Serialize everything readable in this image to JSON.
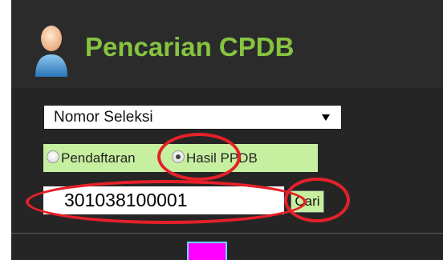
{
  "header": {
    "title": "Pencarian CPDB",
    "avatar_icon": "user-avatar-icon"
  },
  "form": {
    "search_type": {
      "selected": "Nomor Seleksi"
    },
    "radio_options": [
      {
        "label": "Pendaftaran",
        "checked": false
      },
      {
        "label": "Hasil PPDB",
        "checked": true
      }
    ],
    "search_input_value": "301038100001",
    "search_button_label": "Cari"
  },
  "colors": {
    "title_green": "#86c440",
    "panel_dark": "#252525",
    "highlight_green": "#c6f0a0",
    "annotation_red": "#e6202a",
    "marker_magenta": "#ff00ff"
  }
}
